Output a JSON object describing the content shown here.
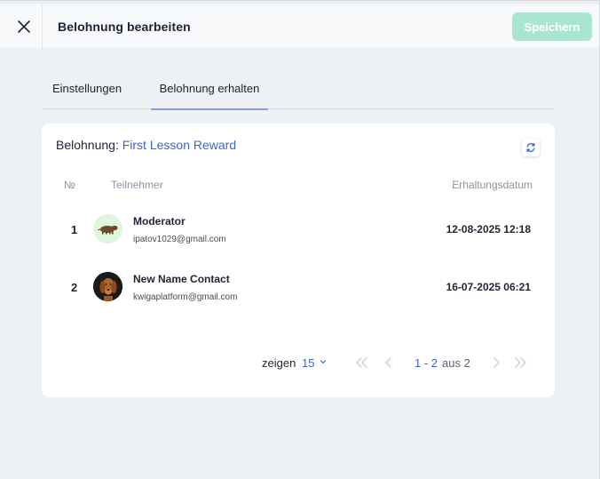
{
  "header": {
    "title": "Belohnung bearbeiten",
    "save_label": "Speichern"
  },
  "tabs": [
    {
      "label": "Einstellungen",
      "active": false
    },
    {
      "label": "Belohnung erhalten",
      "active": true
    }
  ],
  "reward": {
    "prefix": "Belohnung:",
    "name": "First Lesson Reward"
  },
  "table": {
    "columns": [
      "№",
      "Teilnehmer",
      "Erhaltungsdatum"
    ],
    "rows": [
      {
        "number": "1",
        "name": "Moderator",
        "email": "ipatov1029@gmail.com",
        "date": "12-08-2025 12:18",
        "avatar": "capybara-avatar"
      },
      {
        "number": "2",
        "name": "New Name Contact",
        "email": "kwigaplatform@gmail.com",
        "date": "16-07-2025 06:21",
        "avatar": "dog-avatar"
      }
    ]
  },
  "pagination": {
    "show_label": "zeigen",
    "page_size": "15",
    "range": "1 - 2",
    "of_label": "aus 2"
  },
  "colors": {
    "accent": "#3a63d6",
    "save_disabled": "#a9e6cf",
    "background": "#eef1f3"
  }
}
